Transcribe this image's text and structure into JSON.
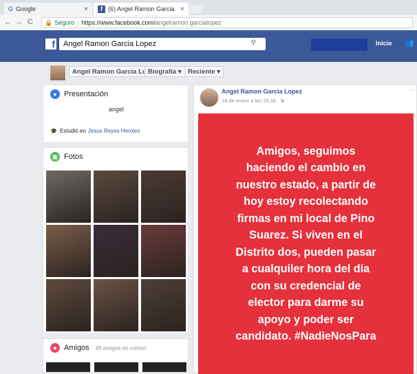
{
  "browser": {
    "tabs": [
      {
        "label": "Google",
        "icon": "google-icon"
      },
      {
        "label": "(6) Angel Ramon Garcia",
        "icon": "facebook-icon"
      }
    ],
    "close_glyph": "×",
    "nav": {
      "back": "←",
      "forward": "→",
      "reload": "C"
    },
    "secure_label": "Seguro",
    "url_host": "https://www.facebook.com/",
    "url_path": "angelramon.garcialopez"
  },
  "fb_header": {
    "logo": "f",
    "search_value": "Angel Ramon Garcia Lopez",
    "search_icon": "search-icon",
    "home_label": "Inicio"
  },
  "profile_nav": {
    "name": "Angel Ramon Garcia Lopez",
    "biography": "Biografía ▾",
    "recent": "Reciente ▾"
  },
  "intro": {
    "title": "Presentación",
    "bio": "angel",
    "studied_prefix": "Estudió en",
    "studied_school": "Jesus Reyes Heroles"
  },
  "photos": {
    "title": "Fotos",
    "tiles": [
      {
        "color": "#6d6a64"
      },
      {
        "color": "#5b4a3f"
      },
      {
        "color": "#4a3a35"
      },
      {
        "color": "#7a5d4a"
      },
      {
        "color": "#3b2b3a"
      },
      {
        "color": "#6a3b3a"
      },
      {
        "color": "#5e4a3c"
      },
      {
        "color": "#6b5446"
      },
      {
        "color": "#4d3f36"
      }
    ]
  },
  "friends": {
    "title": "Amigos",
    "subtitle": "· 48 amigos en común"
  },
  "post": {
    "author": "Angel Ramon Garcia Lopez",
    "date": "19 de enero a las 19:38 · ⊕",
    "more": "··",
    "lines": [
      "Amigos, seguimos",
      "haciendo el cambio en",
      "nuestro estado, a partir de",
      "hoy estoy recolectando",
      "firmas en mi local de Pino",
      "Suarez. Si viven en el",
      "Distrito dos,  pueden pasar",
      "a cualquiler hora del día",
      "con su credencial de",
      "elector para darme su",
      "apoyo y poder ser",
      "candidato. #NadieNosPara"
    ],
    "background_color": "#e5313b"
  }
}
